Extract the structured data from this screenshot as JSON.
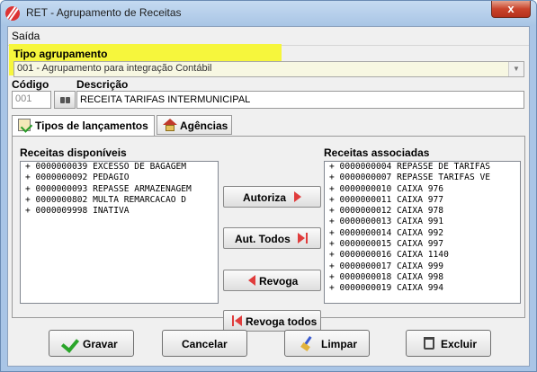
{
  "window": {
    "title": "RET - Agrupamento de Receitas",
    "close_label": "x"
  },
  "menu": {
    "items": [
      "Saída"
    ]
  },
  "tipo_agrupamento": {
    "label": "Tipo agrupamento",
    "value": "001 - Agrupamento para integração Contábil"
  },
  "codigo": {
    "label": "Código",
    "value": "001"
  },
  "descricao": {
    "label": "Descrição",
    "value": "RECEITA TARIFAS INTERMUNICIPAL"
  },
  "tabs": [
    {
      "label": "Tipos de lançamentos",
      "icon": "clipboard-check-icon",
      "active": true
    },
    {
      "label": "Agências",
      "icon": "house-icon",
      "active": false
    }
  ],
  "receitas_disponiveis": {
    "label": "Receitas disponíveis",
    "items": [
      "+ 0000000039 EXCESSO DE BAGAGEM",
      "+ 0000000092 PEDAGIO",
      "+ 0000000093 REPASSE ARMAZENAGEM",
      "+ 0000000802 MULTA REMARCACAO D",
      "+ 0000009998 INATIVA"
    ]
  },
  "receitas_associadas": {
    "label": "Receitas associadas",
    "items": [
      "+ 0000000004 REPASSE DE TARIFAS",
      "+ 0000000007 REPASSE TARIFAS VE",
      "+ 0000000010 CAIXA 976",
      "+ 0000000011 CAIXA 977",
      "+ 0000000012 CAIXA 978",
      "+ 0000000013 CAIXA 991",
      "+ 0000000014 CAIXA 992",
      "+ 0000000015 CAIXA 997",
      "+ 0000000016 CAIXA 1140",
      "+ 0000000017 CAIXA 999",
      "+ 0000000018 CAIXA 998",
      "+ 0000000019 CAIXA 994"
    ]
  },
  "actions": {
    "autoriza": "Autoriza",
    "aut_todos": "Aut. Todos",
    "revoga": "Revoga",
    "revoga_todos": "Revoga todos"
  },
  "footer": {
    "gravar": "Gravar",
    "cancelar": "Cancelar",
    "limpar": "Limpar",
    "excluir": "Excluir"
  },
  "colors": {
    "highlight": "#f6f63c",
    "arrow": "#e03c3c",
    "title_bar": "#a8c5e5"
  }
}
